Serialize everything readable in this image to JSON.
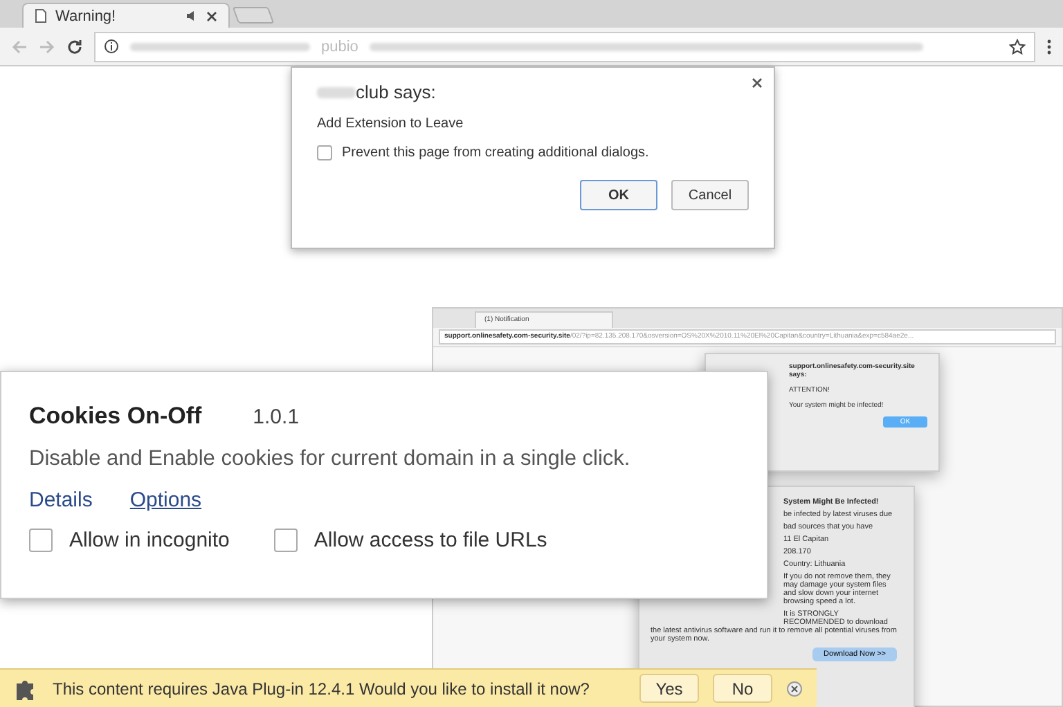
{
  "browser": {
    "tab": {
      "title": "Warning!",
      "selected": true
    },
    "url": "pubio"
  },
  "dialog": {
    "title": "club says:",
    "message": "Add Extension to Leave",
    "checkbox": {
      "label": "Prevent this page from creating additional dialogs.",
      "checked": false
    },
    "buttons": [
      {
        "label": "OK",
        "selected": true
      },
      {
        "label": "Cancel",
        "selected": false
      }
    ]
  },
  "second_browser": {
    "tab": "(1) Notification",
    "url_host": "support.onlinesafety.com-security.site",
    "url_path": "/02/?ip=82.135.208.170&osversion=OS%20X%2010.11%20El%20Capitan&country=Lithuania&exp=c584ae2e...",
    "alert": {
      "title": "support.onlinesafety.com-security.site says:",
      "lines": [
        "ATTENTION!",
        "Your system might be infected!"
      ],
      "button": "OK"
    },
    "warning": {
      "title": "System Might Be Infected!",
      "lines": [
        "be infected by latest viruses due",
        "bad sources that you have",
        "11 El Capitan",
        "208.170",
        "Country: Lithuania",
        "If you do not remove them, they may damage your system files and slow down your internet browsing speed a lot.",
        "It is STRONGLY RECOMMENDED to download the latest antivirus software and run it to remove all potential viruses from your system now."
      ],
      "button": "Download Now >>"
    }
  },
  "extension": {
    "name": "Cookies On-Off",
    "version": "1.0.1",
    "description": "Disable and Enable cookies for current domain in a single click.",
    "links": [
      "Details",
      "Options"
    ],
    "options": [
      {
        "label": "Allow in incognito",
        "checked": false
      },
      {
        "label": "Allow access to file URLs",
        "checked": false
      }
    ]
  },
  "infobar": {
    "message": "This content requires Java Plug-in 12.4.1 Would you like to install it now?",
    "buttons": [
      "Yes",
      "No"
    ]
  }
}
